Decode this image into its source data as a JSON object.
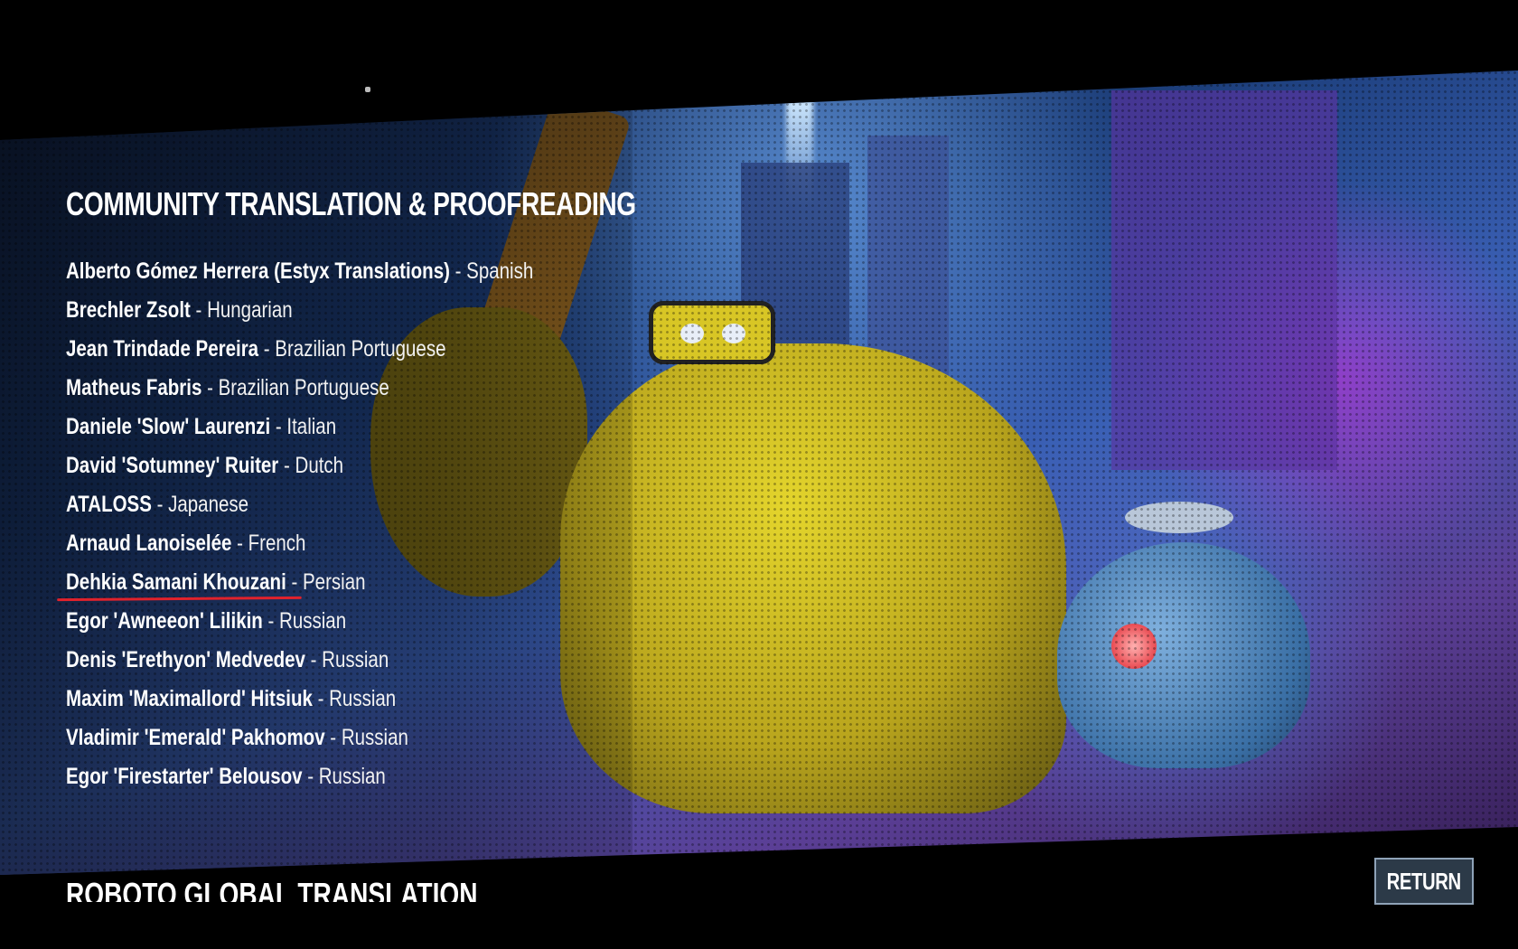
{
  "section": {
    "title": "COMMUNITY TRANSLATION & PROOFREADING"
  },
  "credits": [
    {
      "name": "Alberto Gómez Herrera (Estyx Translations)",
      "language": "Spanish"
    },
    {
      "name": "Brechler Zsolt",
      "language": "Hungarian"
    },
    {
      "name": "Jean Trindade Pereira",
      "language": "Brazilian Portuguese"
    },
    {
      "name": "Matheus Fabris",
      "language": "Brazilian Portuguese"
    },
    {
      "name": "Daniele 'Slow' Laurenzi",
      "language": "Italian"
    },
    {
      "name": "David 'Sotumney' Ruiter",
      "language": "Dutch"
    },
    {
      "name": "ATALOSS",
      "language": "Japanese"
    },
    {
      "name": "Arnaud Lanoiselée",
      "language": "French"
    },
    {
      "name": "Dehkia Samani Khouzani",
      "language": "Persian"
    },
    {
      "name": "Egor 'Awneeon' Lilikin",
      "language": "Russian"
    },
    {
      "name": "Denis 'Erethyon' Medvedev",
      "language": "Russian"
    },
    {
      "name": "Maxim 'Maximallord' Hitsiuk",
      "language": "Russian"
    },
    {
      "name": "Vladimir 'Emerald' Pakhomov",
      "language": "Russian"
    },
    {
      "name": "Egor 'Firestarter' Belousov",
      "language": "Russian"
    }
  ],
  "separator": " - ",
  "highlighted_index": 8,
  "highlight_color": "#e0222c",
  "next_section": {
    "title": "ROBOTO GLOBAL TRANSLATION"
  },
  "return_label": "RETURN"
}
